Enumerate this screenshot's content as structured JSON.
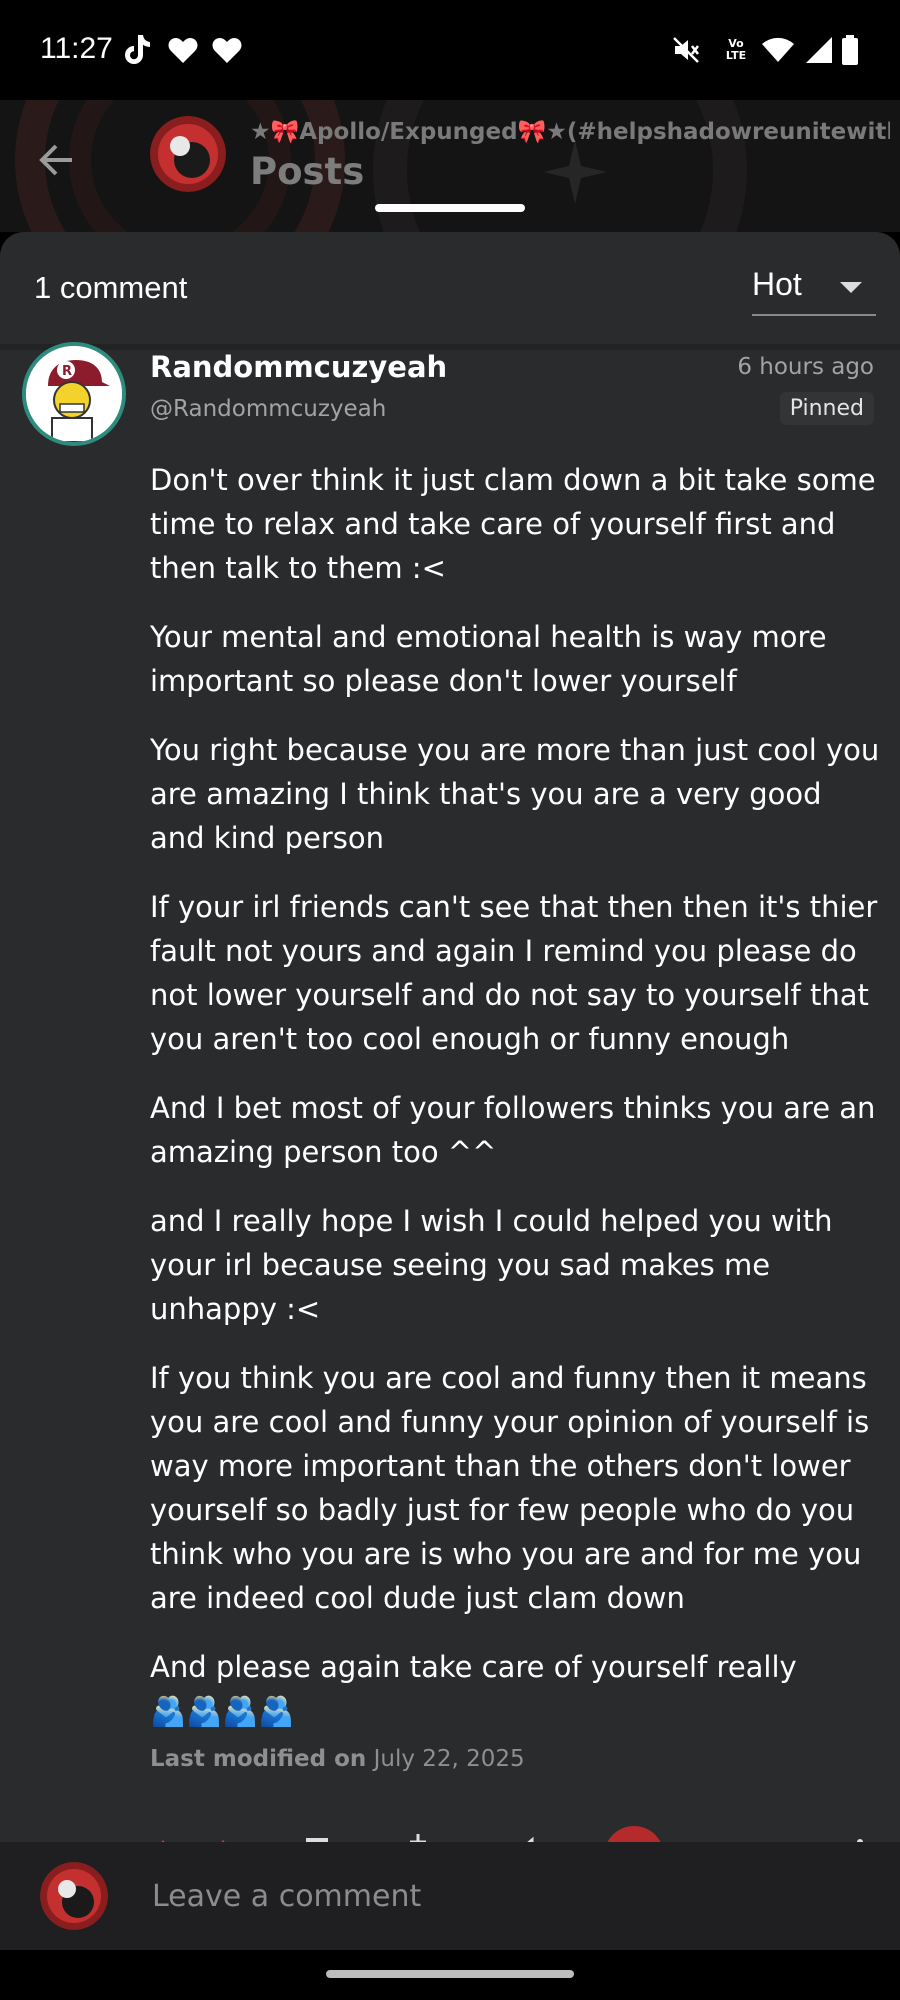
{
  "status_bar": {
    "time": "11:27",
    "left_icons": [
      "tiktok-icon",
      "heart-icon",
      "heart-icon"
    ],
    "right_icons": [
      "mute-icon",
      "volte-icon",
      "wifi-icon",
      "signal-icon",
      "battery-icon"
    ],
    "volte_label": "Vo LTE"
  },
  "header": {
    "community_name": "★🎀Apollo/Expunged🎀★(#helpshadowreunitewithsn",
    "title": "Posts",
    "back_icon": "arrow-left-icon"
  },
  "sheet": {
    "comment_count": "1 comment",
    "sort": {
      "selected": "Hot"
    }
  },
  "comment": {
    "author_name": "Randommcuzyeah",
    "author_handle": "@Randommcuzyeah",
    "timestamp": "6 hours ago",
    "pinned": "Pinned",
    "paragraphs": [
      "Don't over think it just clam down a bit take some time to relax and take care of yourself first and then talk to them :<",
      "Your mental and emotional health is way more important so please don't lower yourself",
      "You  right because you are more than just cool you are amazing I think that's you are  a very good and kind person",
      "If your irl friends can't see that then then it's thier fault not yours and again I remind you please do not lower yourself and do not say  to yourself that you aren't too cool enough or funny enough",
      "And I bet most of your followers thinks you are an amazing person too ^^",
      "and I really hope I wish I could helped you with your irl because seeing you sad makes me unhappy :<",
      "If you think you are cool and funny then it means you are cool and funny your opinion of yourself is way more important than the others don't lower yourself so badly just for few people who do you think who you are is who you are and for me you are indeed cool dude just clam down"
    ],
    "last_paragraph": "And please again take care of yourself really",
    "emoji": "🫂🫂🫂🫂",
    "modified_label": "Last modified on",
    "modified_date": "July 22, 2025"
  },
  "comment_bar": {
    "placeholder": "Leave a comment"
  },
  "colors": {
    "sheet_bg": "#2a2b2d",
    "avatar_ring": "#2e8c7f",
    "muted_text": "#a3a3a3"
  }
}
